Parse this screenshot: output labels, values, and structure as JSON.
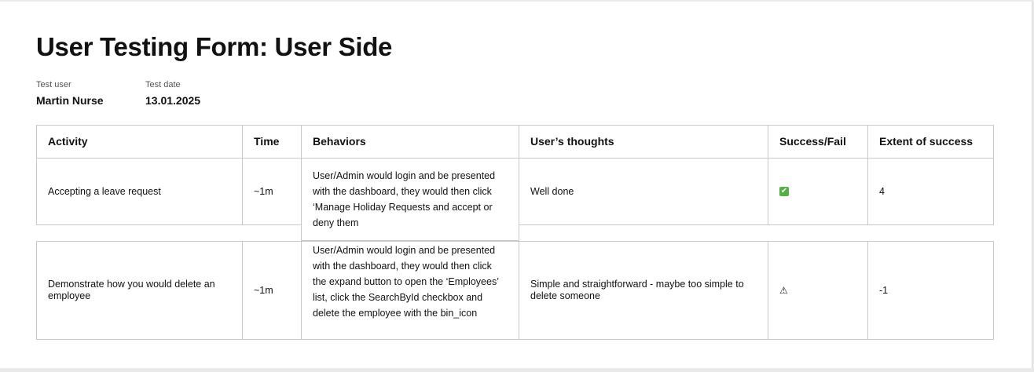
{
  "title": "User Testing Form: User Side",
  "meta": {
    "test_user_label": "Test user",
    "test_user_value": "Martin Nurse",
    "test_date_label": "Test date",
    "test_date_value": "13.01.2025"
  },
  "table": {
    "headers": [
      "Activity",
      "Time",
      "Behaviors",
      "User’s thoughts",
      "Success/Fail",
      "Extent of success"
    ],
    "rows": [
      {
        "activity": "Accepting a leave request",
        "time": "~1m",
        "behaviors": "User/Admin would login and be presented with the dashboard, they would then click ‘Manage Holiday Requests and accept or deny them",
        "thoughts": "Well done",
        "success_icon": "check-mark-icon",
        "success_glyph": "✔",
        "extent": "4"
      },
      {
        "activity": "Demonstrate how you would delete an employee",
        "time": "~1m",
        "behaviors": "User/Admin would login and be presented with the dashboard, they would then click the expand button to open the ‘Employees’ list, click the SearchById checkbox and delete the employee with the bin_icon",
        "thoughts": "Simple and straightforward - maybe too simple to delete someone",
        "success_icon": "warning-icon",
        "success_glyph": "⚠",
        "extent": "-1"
      }
    ]
  }
}
